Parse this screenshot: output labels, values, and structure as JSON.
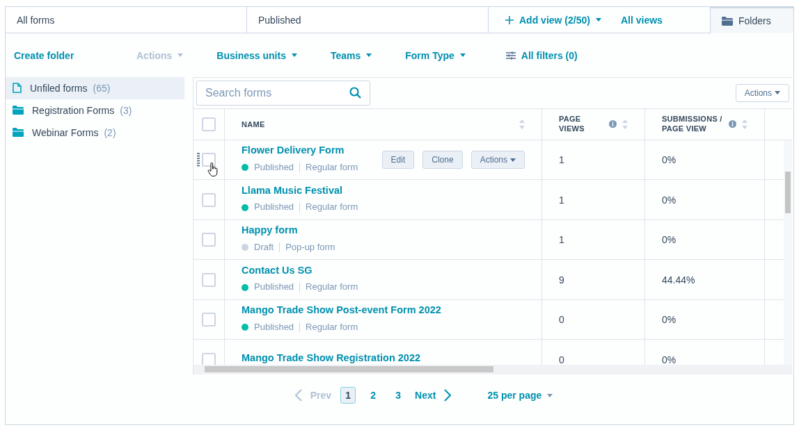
{
  "view_tabs": [
    {
      "label": "All forms",
      "selected": false
    },
    {
      "label": "Published",
      "selected": false
    }
  ],
  "add_view": "Add view (2/50)",
  "all_views": "All views",
  "folders_tab": {
    "label": "Folders",
    "selected": true
  },
  "toolbar": {
    "create_folder": "Create folder",
    "filters": [
      {
        "label": "Actions",
        "disabled": true
      },
      {
        "label": "Business units",
        "disabled": false
      },
      {
        "label": "Teams",
        "disabled": false
      },
      {
        "label": "Form Type",
        "disabled": false
      }
    ],
    "all_filters": "All filters (0)"
  },
  "folders": [
    {
      "name": "Unfiled forms",
      "count": "(65)",
      "kind": "file",
      "selected": true
    },
    {
      "name": "Registration Forms",
      "count": "(3)",
      "kind": "folder",
      "selected": false
    },
    {
      "name": "Webinar Forms",
      "count": "(2)",
      "kind": "folder",
      "selected": false
    }
  ],
  "search": {
    "placeholder": "Search forms"
  },
  "select_all": {
    "checked": false
  },
  "table_actions": "Actions",
  "columns": [
    {
      "label": "NAME",
      "info": false
    },
    {
      "label": "PAGE VIEWS",
      "info": true
    },
    {
      "label": "SUBMISSIONS / PAGE VIEW",
      "info": true
    }
  ],
  "rows": [
    {
      "name": "Flower Delivery Form",
      "status": "Published",
      "color": "#00bda5",
      "type": "Regular form",
      "page_views": "1",
      "rate": "0%",
      "checked": false,
      "hovered": true,
      "actions": [
        "Edit",
        "Clone",
        "Actions"
      ]
    },
    {
      "name": "Llama Music Festival",
      "status": "Published",
      "color": "#00bda5",
      "type": "Regular form",
      "page_views": "1",
      "rate": "0%",
      "checked": false,
      "hovered": false
    },
    {
      "name": "Happy form",
      "status": "Draft",
      "color": "#cbd6e2",
      "type": "Pop-up form",
      "page_views": "1",
      "rate": "0%",
      "checked": false,
      "hovered": false
    },
    {
      "name": "Contact Us SG",
      "status": "Published",
      "color": "#00bda5",
      "type": "Regular form",
      "page_views": "9",
      "rate": "44.44%",
      "checked": false,
      "hovered": false
    },
    {
      "name": "Mango Trade Show Post-event Form 2022",
      "status": "Published",
      "color": "#00bda5",
      "type": "Regular form",
      "page_views": "0",
      "rate": "0%",
      "checked": false,
      "hovered": false
    },
    {
      "name": "Mango Trade Show Registration 2022",
      "page_views": "0",
      "rate": "0%",
      "checked": false,
      "hovered": false
    }
  ],
  "pagination": {
    "prev": "Prev",
    "pages": [
      {
        "label": "1",
        "selected": true
      },
      {
        "label": "2",
        "selected": false
      },
      {
        "label": "3",
        "selected": false
      }
    ],
    "next": "Next",
    "per_page": "25 per page"
  }
}
